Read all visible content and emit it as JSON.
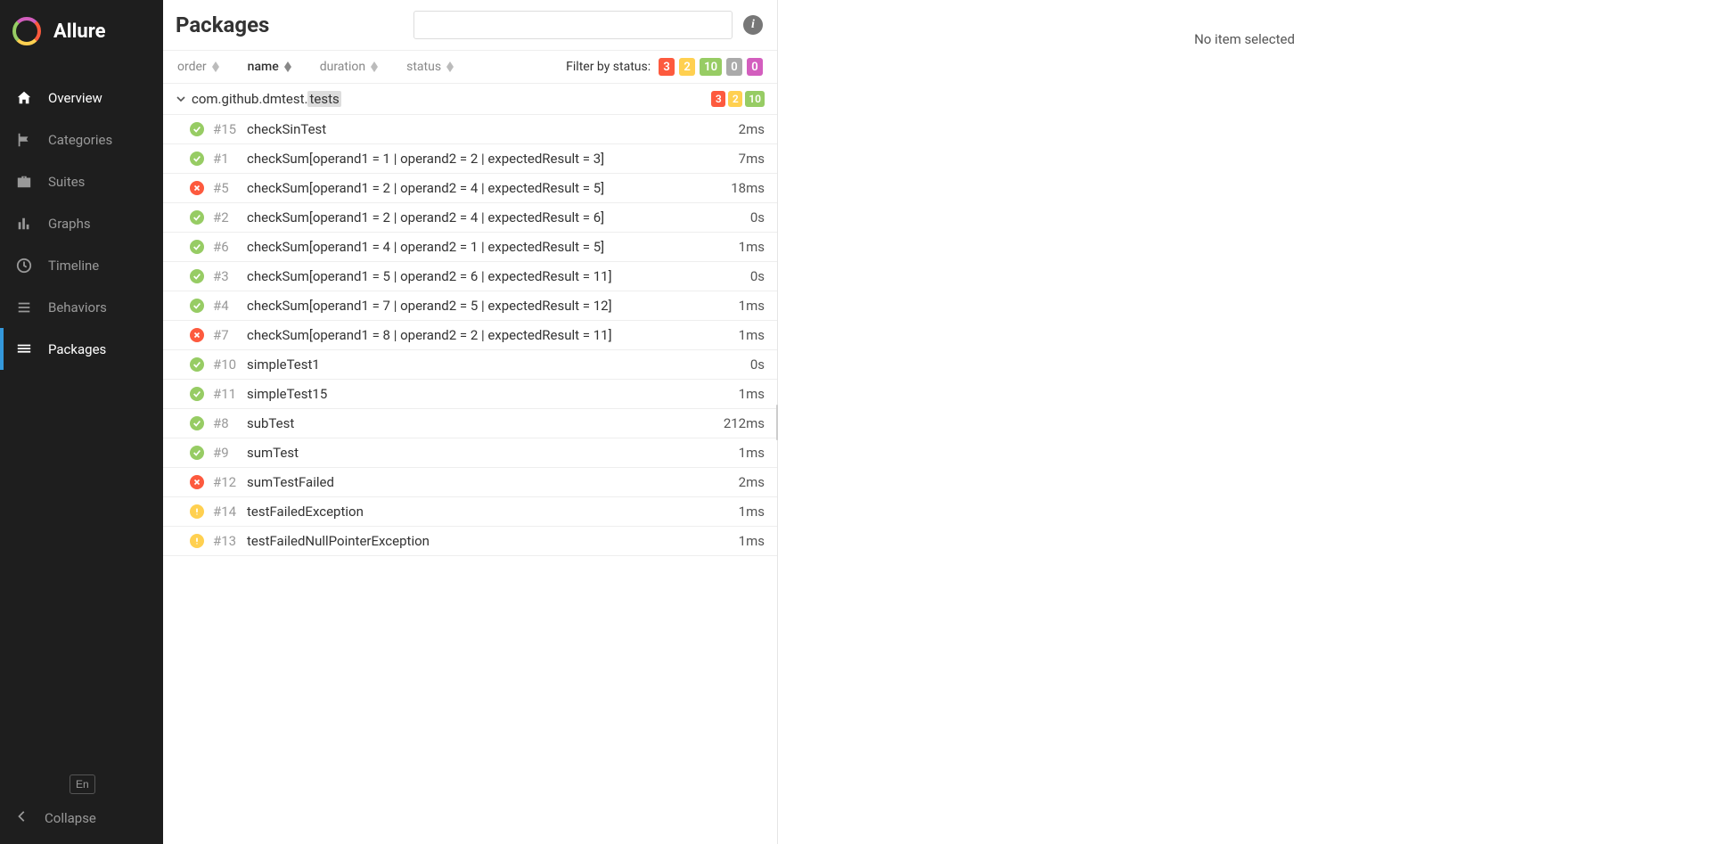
{
  "brand": "Allure",
  "nav": [
    {
      "label": "Overview",
      "icon": "home"
    },
    {
      "label": "Categories",
      "icon": "flag"
    },
    {
      "label": "Suites",
      "icon": "briefcase"
    },
    {
      "label": "Graphs",
      "icon": "bar"
    },
    {
      "label": "Timeline",
      "icon": "clock"
    },
    {
      "label": "Behaviors",
      "icon": "list"
    },
    {
      "label": "Packages",
      "icon": "align"
    }
  ],
  "nav_active_index": 6,
  "lang": "En",
  "collapse": "Collapse",
  "page_title": "Packages",
  "search_placeholder": "",
  "sort_columns": {
    "order": "order",
    "name": "name",
    "duration": "duration",
    "status": "status"
  },
  "sort_active": "name",
  "filter_label": "Filter by status:",
  "filter_badges": {
    "failed": "3",
    "broken": "2",
    "passed": "10",
    "skipped": "0",
    "unknown": "0"
  },
  "group": {
    "name_prefix": "com.github.dmtest.",
    "name_highlight": "tests",
    "badges": {
      "failed": "3",
      "broken": "2",
      "passed": "10"
    }
  },
  "tests": [
    {
      "status": "passed",
      "id": "#15",
      "name": "checkSinTest",
      "duration": "2ms"
    },
    {
      "status": "passed",
      "id": "#1",
      "name": "checkSum[operand1 = 1 | operand2 = 2 | expectedResult = 3]",
      "duration": "7ms"
    },
    {
      "status": "failed",
      "id": "#5",
      "name": "checkSum[operand1 = 2 | operand2 = 4 | expectedResult = 5]",
      "duration": "18ms"
    },
    {
      "status": "passed",
      "id": "#2",
      "name": "checkSum[operand1 = 2 | operand2 = 4 | expectedResult = 6]",
      "duration": "0s"
    },
    {
      "status": "passed",
      "id": "#6",
      "name": "checkSum[operand1 = 4 | operand2 = 1 | expectedResult = 5]",
      "duration": "1ms"
    },
    {
      "status": "passed",
      "id": "#3",
      "name": "checkSum[operand1 = 5 | operand2 = 6 | expectedResult = 11]",
      "duration": "0s"
    },
    {
      "status": "passed",
      "id": "#4",
      "name": "checkSum[operand1 = 7 | operand2 = 5 | expectedResult = 12]",
      "duration": "1ms"
    },
    {
      "status": "failed",
      "id": "#7",
      "name": "checkSum[operand1 = 8 | operand2 = 2 | expectedResult = 11]",
      "duration": "1ms"
    },
    {
      "status": "passed",
      "id": "#10",
      "name": "simpleTest1",
      "duration": "0s"
    },
    {
      "status": "passed",
      "id": "#11",
      "name": "simpleTest15",
      "duration": "1ms"
    },
    {
      "status": "passed",
      "id": "#8",
      "name": "subTest",
      "duration": "212ms"
    },
    {
      "status": "passed",
      "id": "#9",
      "name": "sumTest",
      "duration": "1ms"
    },
    {
      "status": "failed",
      "id": "#12",
      "name": "sumTestFailed",
      "duration": "2ms"
    },
    {
      "status": "broken",
      "id": "#14",
      "name": "testFailedException",
      "duration": "1ms"
    },
    {
      "status": "broken",
      "id": "#13",
      "name": "testFailedNullPointerException",
      "duration": "1ms"
    }
  ],
  "detail_empty": "No item selected"
}
